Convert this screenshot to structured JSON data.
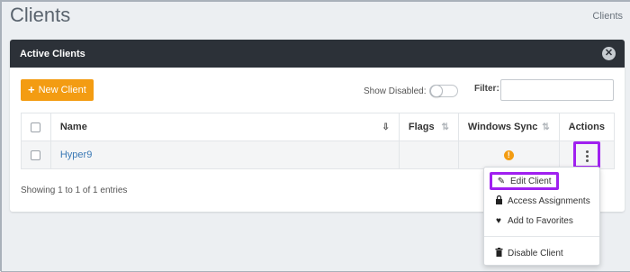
{
  "page": {
    "title": "Clients",
    "breadcrumb": "Clients"
  },
  "panel": {
    "title": "Active Clients"
  },
  "toolbar": {
    "new_client_label": "New Client",
    "show_disabled_label": "Show Disabled:",
    "show_disabled_on": false,
    "filter_label": "Filter:",
    "filter_value": ""
  },
  "table": {
    "columns": [
      "Name",
      "Flags",
      "Windows Sync",
      "Actions"
    ],
    "rows": [
      {
        "name": "Hyper9",
        "flags": "",
        "windows_sync_status": "warning-icon"
      }
    ]
  },
  "footer": {
    "entries_text": "Showing 1 to 1 of 1 entries"
  },
  "actions_menu": {
    "items": [
      {
        "label": "Edit Client",
        "icon": "pencil-icon"
      },
      {
        "label": "Access Assignments",
        "icon": "lock-icon"
      },
      {
        "label": "Add to Favorites",
        "icon": "heart-icon"
      },
      {
        "label": "Disable Client",
        "icon": "trash-icon"
      }
    ]
  },
  "colors": {
    "accent": "#f39c12",
    "highlight": "#a020f0",
    "header_bg": "#2c3138",
    "link": "#3a79b5"
  }
}
